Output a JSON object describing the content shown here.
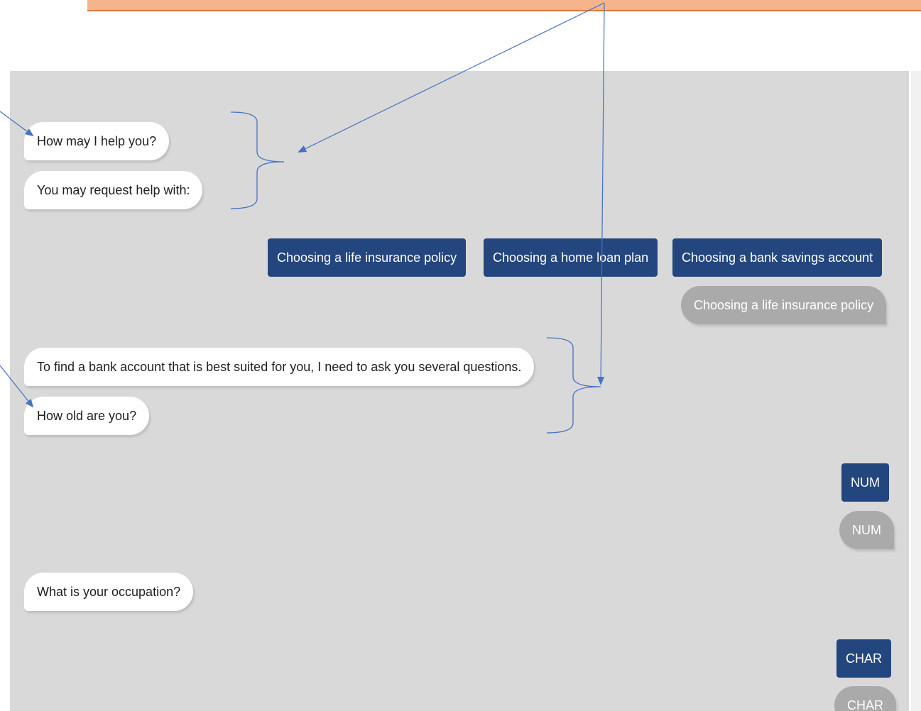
{
  "chat": {
    "bot_messages": [
      "How may I help you?",
      "You may request help with:",
      "To find a bank account that is best suited for you, I need to ask you several questions.",
      "How old are you?",
      "What is your occupation?"
    ],
    "options": [
      "Choosing a life insurance policy",
      "Choosing a home loan plan",
      "Choosing a bank savings account"
    ],
    "user_replies": [
      "Choosing a life insurance policy",
      "NUM",
      "CHAR"
    ],
    "input_buttons": {
      "num_label": "NUM",
      "char_label": "CHAR"
    }
  },
  "colors": {
    "panel_bg": "#d9d9d9",
    "option_button": "#24467f",
    "user_bubble": "#aaaaaa",
    "bot_bubble": "#ffffff",
    "annotation_line": "#4472c4",
    "banner_fill": "#f6b48b"
  }
}
